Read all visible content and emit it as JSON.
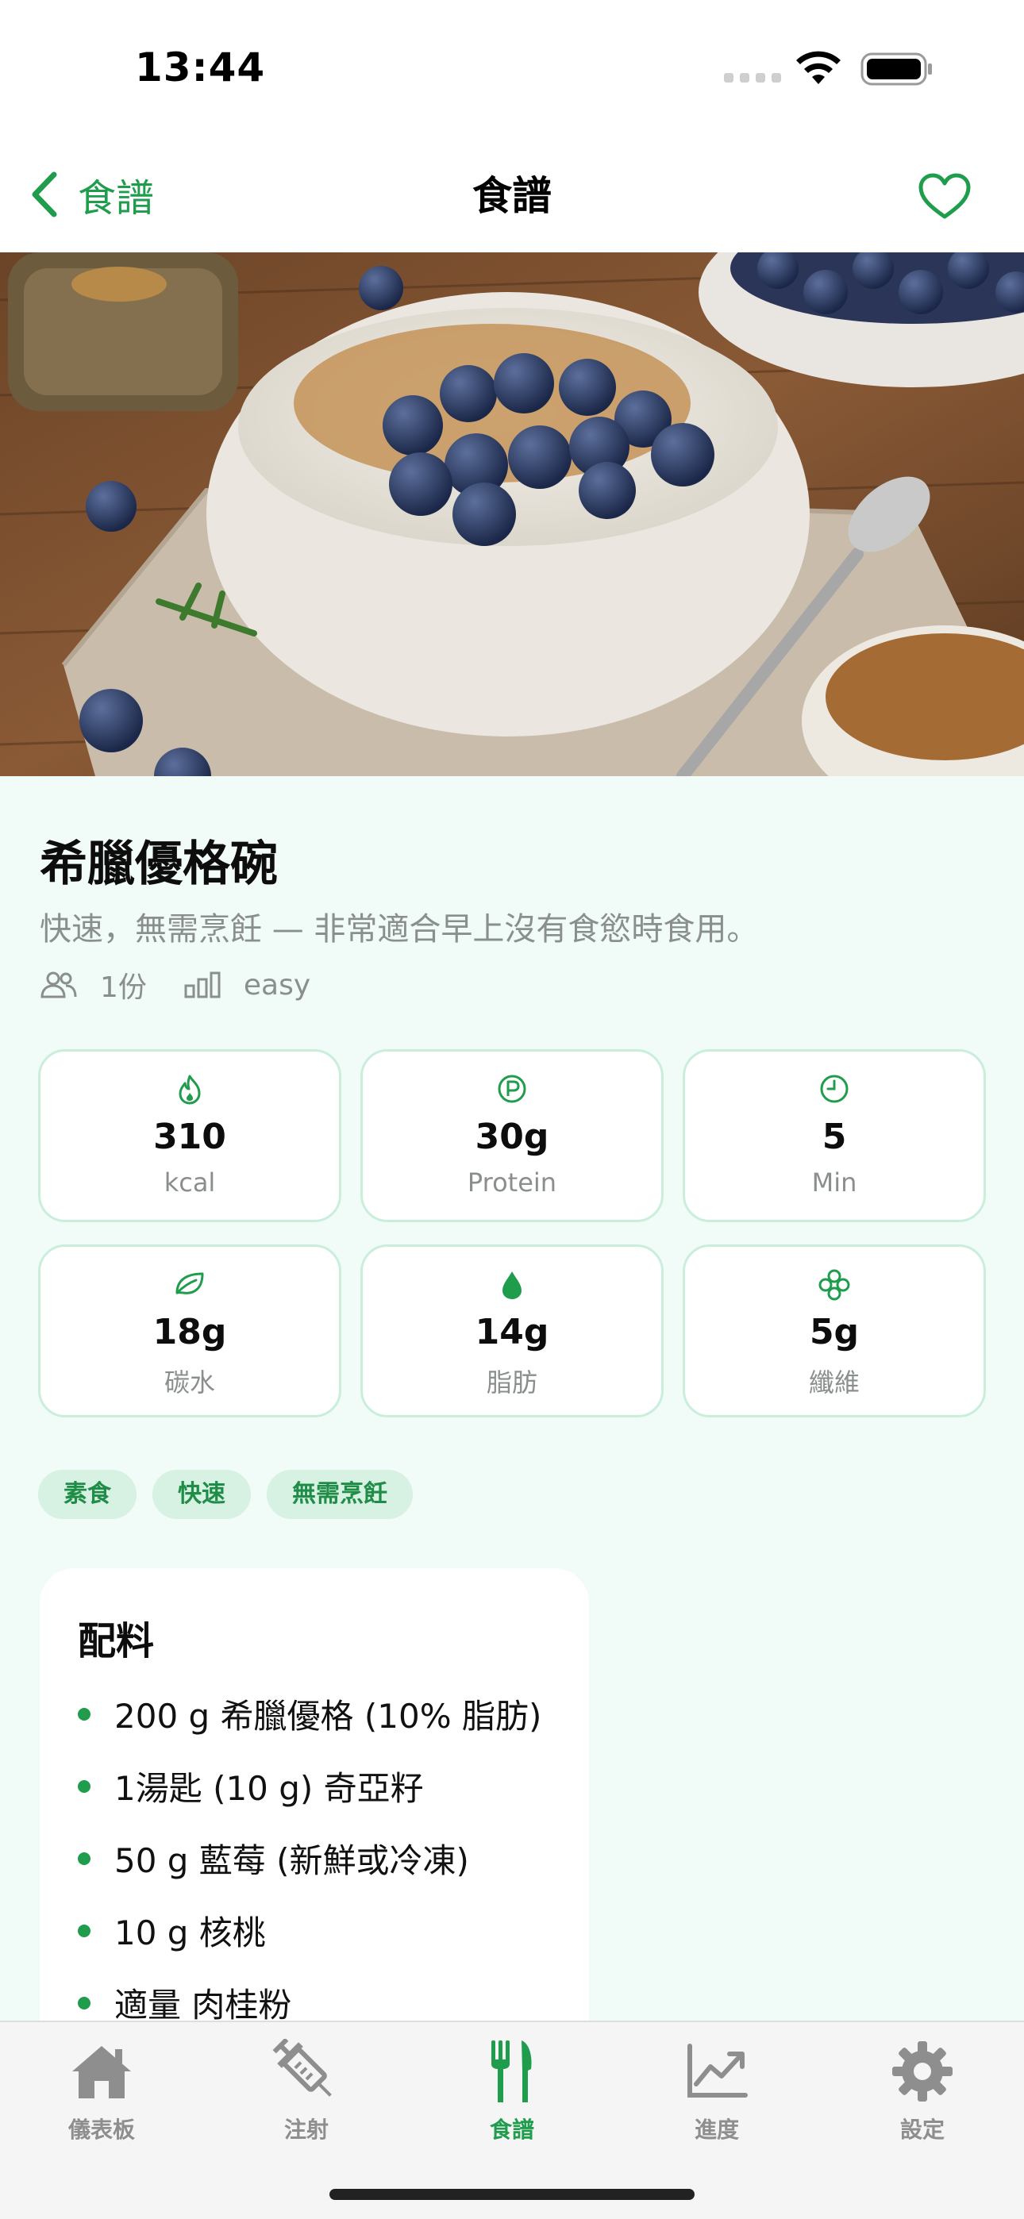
{
  "status_bar": {
    "time": "13:44"
  },
  "nav": {
    "back_label": "食譜",
    "title": "食譜"
  },
  "recipe": {
    "title": "希臘優格碗",
    "description": "快速，無需烹飪 — 非常適合早上沒有食慾時食用。",
    "servings": "1份",
    "difficulty": "easy"
  },
  "stats": [
    {
      "icon": "flame-icon",
      "value": "310",
      "label": "kcal"
    },
    {
      "icon": "protein-icon",
      "value": "30g",
      "label": "Protein"
    },
    {
      "icon": "clock-icon",
      "value": "5",
      "label": "Min"
    },
    {
      "icon": "leaf-icon",
      "value": "18g",
      "label": "碳水"
    },
    {
      "icon": "droplet-icon",
      "value": "14g",
      "label": "脂肪"
    },
    {
      "icon": "fiber-icon",
      "value": "5g",
      "label": "纖維"
    }
  ],
  "tags": [
    "素食",
    "快速",
    "無需烹飪"
  ],
  "ingredients": {
    "title": "配料",
    "items": [
      "200 g 希臘優格 (10% 脂肪)",
      "1湯匙 (10 g) 奇亞籽",
      "50 g 藍莓 (新鮮或冷凍)",
      "10 g 核桃",
      "適量 肉桂粉"
    ]
  },
  "tab_bar": {
    "tabs": [
      {
        "label": "儀表板",
        "icon": "house-icon"
      },
      {
        "label": "注射",
        "icon": "syringe-icon"
      },
      {
        "label": "食譜",
        "icon": "fork-knife-icon"
      },
      {
        "label": "進度",
        "icon": "chart-icon"
      },
      {
        "label": "設定",
        "icon": "gear-icon"
      }
    ],
    "active": "食譜"
  },
  "colors": {
    "accent": "#1f9d4d",
    "background": "#f1fbf8",
    "card_border": "#c9efdc",
    "tag_bg": "#d7f1e2",
    "muted_text": "#8a8f8d"
  }
}
